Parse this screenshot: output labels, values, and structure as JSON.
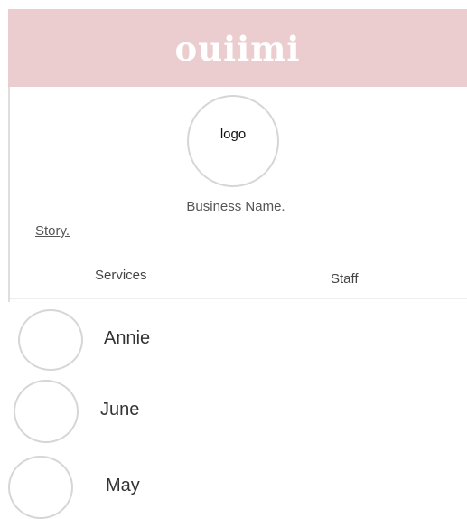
{
  "header": {
    "brand": "ouiimi"
  },
  "profile": {
    "logo_label": "logo",
    "business_name": "Business Name.",
    "story_link": "Story."
  },
  "tabs": [
    {
      "label": "Services"
    },
    {
      "label": "Staff"
    }
  ],
  "staff": [
    {
      "name": "Annie"
    },
    {
      "name": "June"
    },
    {
      "name": "May"
    }
  ],
  "colors": {
    "header_bg": "#eccdcf",
    "brand_text": "#ffffff",
    "circle_border": "#d6d6d6"
  }
}
